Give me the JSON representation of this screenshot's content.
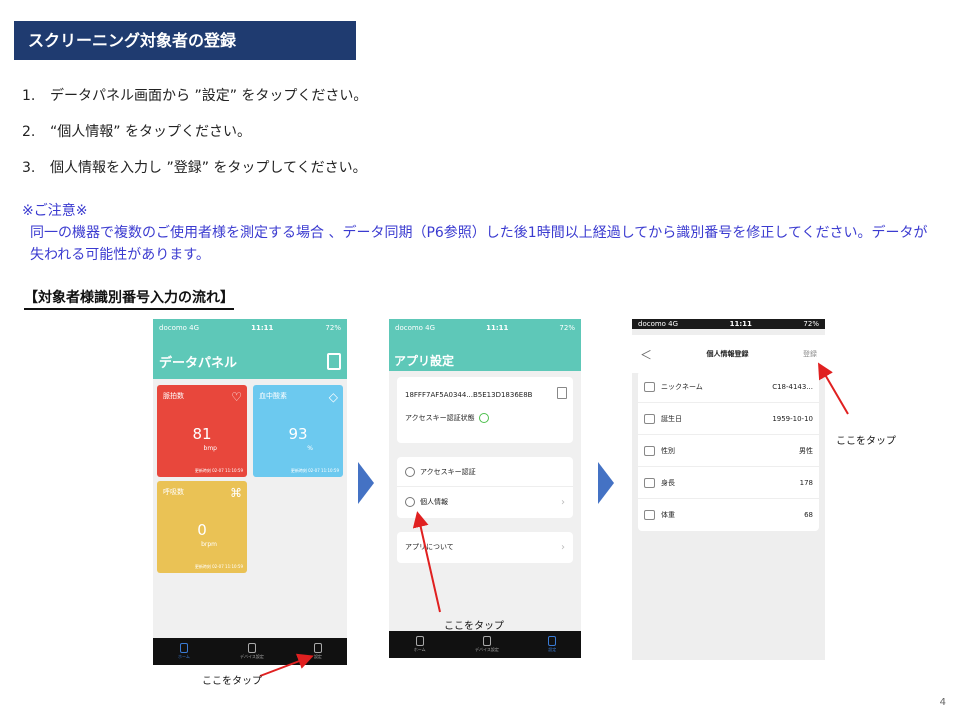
{
  "header": {
    "title": "スクリーニング対象者の登録"
  },
  "steps": [
    {
      "num": "1.",
      "text": "データパネル画面から ”設定” をタップください。"
    },
    {
      "num": "2.",
      "text": "“個人情報” をタップください。"
    },
    {
      "num": "3.",
      "text": "個人情報を入力し ”登録” をタップしてください。"
    }
  ],
  "note": {
    "title": "※ご注意※",
    "body": "同一の機器で複数のご使用者様を測定する場合 、データ同期（P6参照）した後1時間以上経過してから識別番号を修正してください。データが失われる可能性があります。"
  },
  "flow_title": "【対象者様識別番号入力の流れ】",
  "phone1": {
    "status": {
      "carrier": "docomo 4G",
      "time": "11:11",
      "battery": "72%"
    },
    "title": "データパネル",
    "tiles": {
      "pulse": {
        "label": "脈拍数",
        "value": "81",
        "unit": "bmp",
        "time": "更新時刻 02-07 11:10:59"
      },
      "spo2": {
        "label": "血中酸素",
        "value": "93",
        "unit": "%",
        "time": "更新時刻 02-07 11:10:59"
      },
      "resp": {
        "label": "呼吸数",
        "value": "0",
        "unit": "brpm",
        "time": "更新時刻 02-07 11:10:59"
      }
    },
    "nav": {
      "home": "ホーム",
      "device": "デバイス設定",
      "settings": "設定"
    }
  },
  "phone2": {
    "status": {
      "carrier": "docomo 4G",
      "time": "11:11",
      "battery": "72%"
    },
    "title": "アプリ設定",
    "device_id": "18FFF7AF5A0344...B5E13D1836E8B",
    "auth_status": "アクセスキー認証状態",
    "items": {
      "access_key": "アクセスキー認証",
      "personal": "個人情報",
      "about": "アプリについて"
    },
    "nav": {
      "home": "ホーム",
      "device": "デバイス設定",
      "settings": "設定"
    }
  },
  "phone3": {
    "status": {
      "carrier": "docomo 4G",
      "time": "11:11",
      "battery": "72%"
    },
    "back": "＜",
    "title": "個人情報登録",
    "register": "登録",
    "fields": [
      {
        "label": "ニックネーム",
        "value": "C18-4143..."
      },
      {
        "label": "誕生日",
        "value": "1959-10-10"
      },
      {
        "label": "性別",
        "value": "男性"
      },
      {
        "label": "身長",
        "value": "178"
      },
      {
        "label": "体重",
        "value": "68"
      }
    ]
  },
  "callouts": {
    "c1": "ここをタップ",
    "c2": "ここをタップ",
    "c3": "ここをタップ"
  },
  "page_number": "4",
  "colors": {
    "title_bg": "#1f3b70",
    "note_text": "#3b3bd0",
    "teal": "#5ec8b8",
    "arrow": "#4472c4",
    "callout_arrow": "#e02020"
  }
}
